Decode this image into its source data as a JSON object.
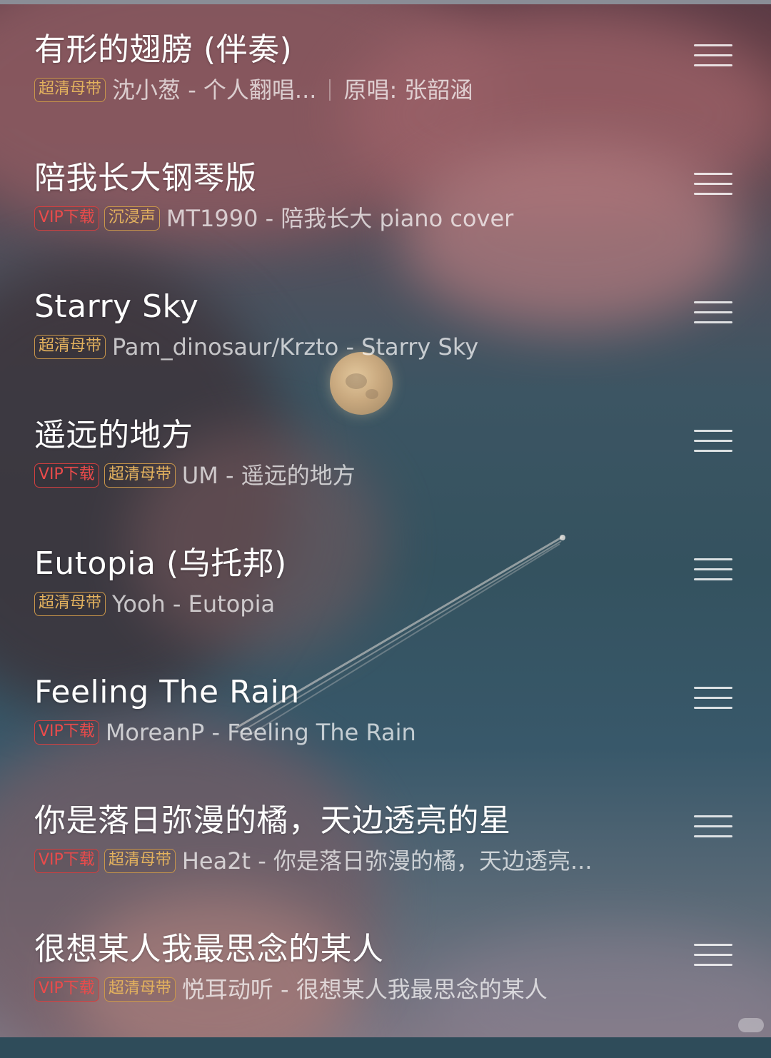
{
  "songs": [
    {
      "title": "有形的翅膀 (伴奏)",
      "tags": [
        {
          "label": "超清母带",
          "kind": "master"
        }
      ],
      "artist_line": "沈小葱 - 个人翻唱...",
      "original_singer": "原唱: 张韶涵"
    },
    {
      "title": "陪我长大钢琴版",
      "tags": [
        {
          "label": "VIP下载",
          "kind": "vip"
        },
        {
          "label": "沉浸声",
          "kind": "immersive"
        }
      ],
      "artist_line": "MT1990 - 陪我长大 piano cover",
      "original_singer": null
    },
    {
      "title": "Starry Sky",
      "tags": [
        {
          "label": "超清母带",
          "kind": "master"
        }
      ],
      "artist_line": "Pam_dinosaur/Krzto - Starry Sky",
      "original_singer": null
    },
    {
      "title": "遥远的地方",
      "tags": [
        {
          "label": "VIP下载",
          "kind": "vip"
        },
        {
          "label": "超清母带",
          "kind": "master"
        }
      ],
      "artist_line": "UM - 遥远的地方",
      "original_singer": null
    },
    {
      "title": "Eutopia (乌托邦)",
      "tags": [
        {
          "label": "超清母带",
          "kind": "master"
        }
      ],
      "artist_line": "Yooh - Eutopia",
      "original_singer": null
    },
    {
      "title": "Feeling The Rain",
      "tags": [
        {
          "label": "VIP下载",
          "kind": "vip"
        }
      ],
      "artist_line": "MoreanP - Feeling The Rain",
      "original_singer": null
    },
    {
      "title": "你是落日弥漫的橘，天边透亮的星",
      "tags": [
        {
          "label": "VIP下载",
          "kind": "vip"
        },
        {
          "label": "超清母带",
          "kind": "master"
        }
      ],
      "artist_line": "Hea2t - 你是落日弥漫的橘，天边透亮...",
      "original_singer": null
    },
    {
      "title": "很想某人我最思念的某人",
      "tags": [
        {
          "label": "VIP下载",
          "kind": "vip"
        },
        {
          "label": "超清母带",
          "kind": "master"
        }
      ],
      "artist_line": "悦耳动听 - 很想某人我最思念的某人",
      "original_singer": null
    }
  ],
  "icons": {
    "drag_handle": "drag-handle-icon"
  },
  "colors": {
    "vip_tag": "#ea4b4b",
    "master_tag": "#e2b15e",
    "title_text": "#ffffff",
    "subtitle_text": "#b8c0c6"
  }
}
